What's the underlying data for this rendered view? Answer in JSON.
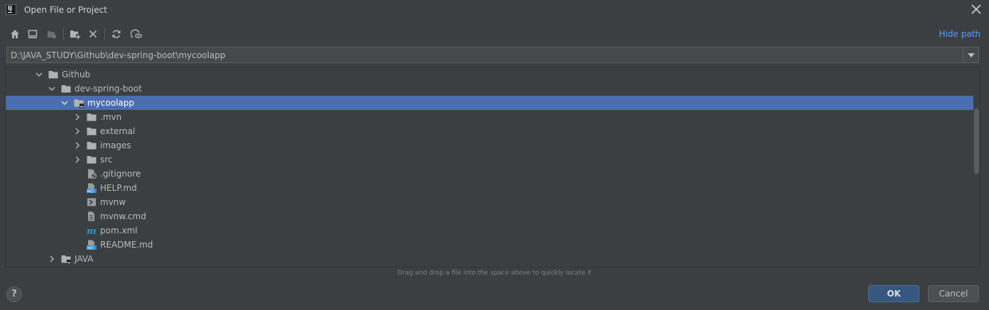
{
  "window": {
    "title": "Open File or Project",
    "app_icon_text": "IJ"
  },
  "toolbar": {
    "buttons": [
      {
        "name": "home-icon"
      },
      {
        "name": "desktop-icon"
      },
      {
        "name": "project-directory-icon"
      },
      {
        "name": "new-folder-icon"
      },
      {
        "name": "delete-icon"
      },
      {
        "name": "refresh-icon"
      },
      {
        "name": "show-hidden-files-icon"
      }
    ],
    "hide_path_label": "Hide path"
  },
  "path": {
    "value": "D:\\JAVA_STUDY\\Github\\dev-spring-boot\\mycoolapp"
  },
  "tree": {
    "rows": [
      {
        "label": "Github",
        "type": "folder",
        "expanded": true,
        "level": 0
      },
      {
        "label": "dev-spring-boot",
        "type": "folder",
        "expanded": true,
        "level": 1
      },
      {
        "label": "mycoolapp",
        "type": "module-folder",
        "expanded": true,
        "level": 2,
        "selected": true
      },
      {
        "label": ".mvn",
        "type": "folder",
        "expanded": false,
        "level": 3
      },
      {
        "label": "external",
        "type": "folder",
        "expanded": false,
        "level": 3
      },
      {
        "label": "images",
        "type": "folder",
        "expanded": false,
        "level": 3
      },
      {
        "label": "src",
        "type": "folder",
        "expanded": false,
        "level": 3
      },
      {
        "label": ".gitignore",
        "type": "gitignore-file",
        "level": 3
      },
      {
        "label": "HELP.md",
        "type": "markdown-file",
        "level": 3
      },
      {
        "label": "mvnw",
        "type": "shell-file",
        "level": 3
      },
      {
        "label": "mvnw.cmd",
        "type": "text-file",
        "level": 3
      },
      {
        "label": "pom.xml",
        "type": "maven-file",
        "level": 3
      },
      {
        "label": "README.md",
        "type": "markdown-file",
        "level": 3
      },
      {
        "label": "JAVA",
        "type": "module-folder",
        "expanded": false,
        "level": 1
      }
    ]
  },
  "hint": "Drag and drop a file into the space above to quickly locate it",
  "footer": {
    "help_label": "?",
    "ok_label": "OK",
    "cancel_label": "Cancel"
  },
  "colors": {
    "background": "#3c3f41",
    "selection": "#4b6eaf",
    "link": "#589df6",
    "ok_button": "#365880"
  }
}
